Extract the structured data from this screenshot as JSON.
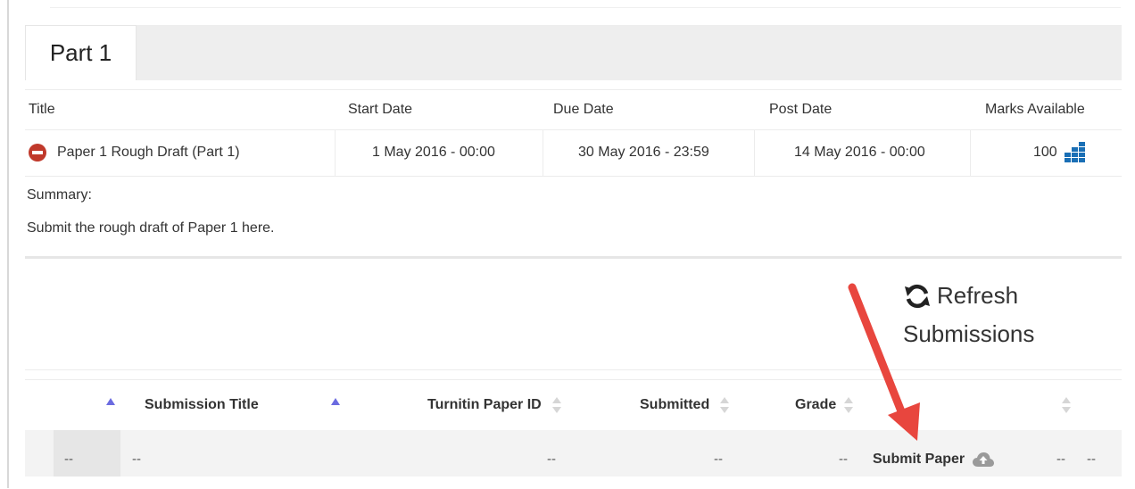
{
  "tabs": [
    {
      "label": "Part 1"
    }
  ],
  "assignment_table": {
    "columns": [
      "Title",
      "Start Date",
      "Due Date",
      "Post Date",
      "Marks Available"
    ],
    "row": {
      "title": "Paper 1 Rough Draft (Part 1)",
      "start_date": "1 May 2016 - 00:00",
      "due_date": "30 May 2016 - 23:59",
      "post_date": "14 May 2016 - 00:00",
      "marks": "100"
    }
  },
  "summary": {
    "label": "Summary:",
    "text": "Submit the rough draft of Paper 1 here."
  },
  "refresh": {
    "line1": "Refresh",
    "line2": "Submissions"
  },
  "submissions_table": {
    "columns": [
      "Submission Title",
      "Turnitin Paper ID",
      "Submitted",
      "Grade"
    ],
    "row": {
      "c0": "--",
      "c1": "--",
      "c2": "--",
      "c3": "--",
      "c4": "--",
      "submit_label": "Submit Paper",
      "c6": "--",
      "c7": "--"
    }
  },
  "colors": {
    "stop_icon": "#c0392b",
    "grid_icon": "#1a6fb5",
    "sort_active": "#6b6be0",
    "arrow": "#e8463e"
  },
  "icons": [
    "minus-circle-icon",
    "grid-icon",
    "refresh-icon",
    "cloud-upload-icon",
    "sort-icon"
  ]
}
